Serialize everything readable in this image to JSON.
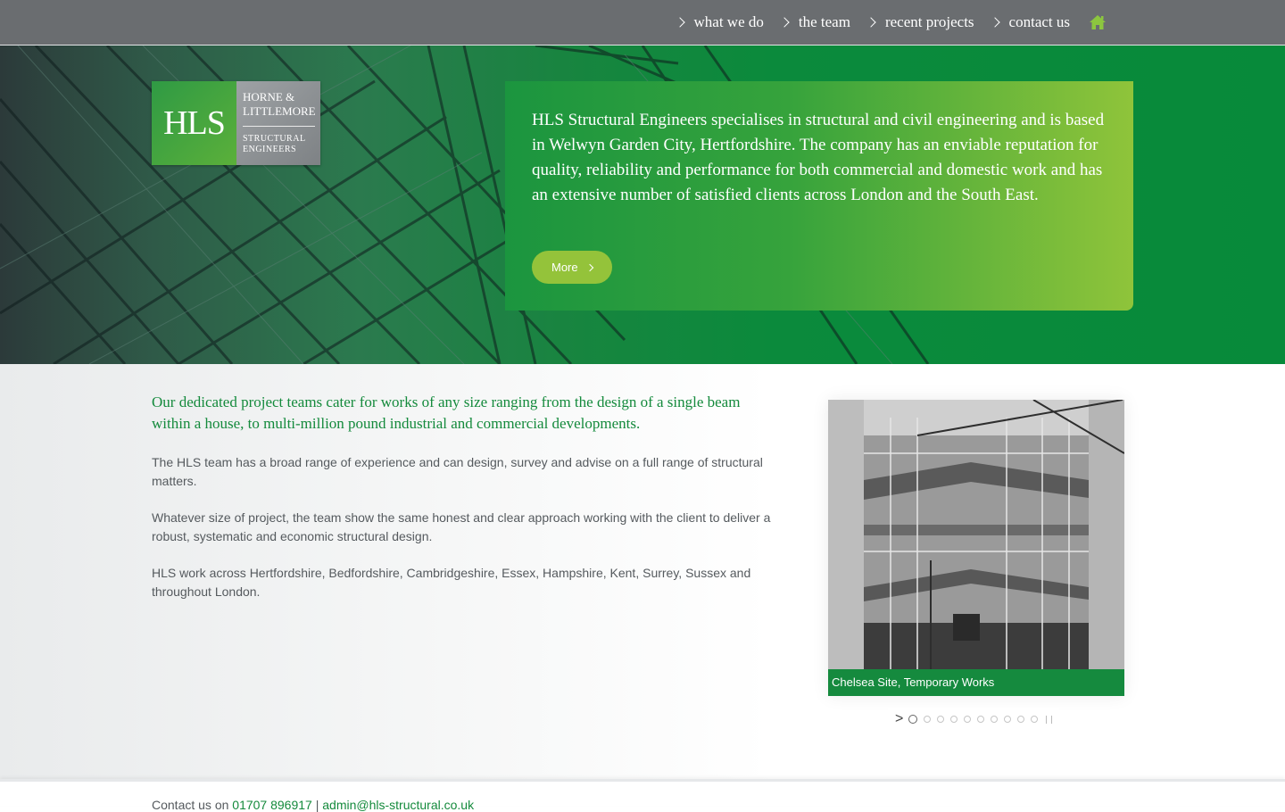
{
  "nav": {
    "items": [
      {
        "label": "what we do"
      },
      {
        "label": "the team"
      },
      {
        "label": "recent projects"
      },
      {
        "label": "contact us"
      }
    ],
    "home_icon": "home-icon",
    "icon_color": "#8cc63f"
  },
  "logo": {
    "mark": "HLS",
    "name_line1": "HORNE &",
    "name_line2": "LITTLEMORE",
    "sub_line1": "STRUCTURAL",
    "sub_line2": "ENGINEERS"
  },
  "hero": {
    "intro": "HLS Structural Engineers specialises in structural and civil engineering and is based in Welwyn Garden City, Hertfordshire. The company has an enviable reputation for quality, reliability and performance for both commercial and domestic work and has an extensive number of satisfied clients across London and the South East.",
    "more_label": "More"
  },
  "content": {
    "lead": "Our dedicated project teams cater for works of any size ranging from the design of a single beam within a house, to multi-million pound industrial and commercial developments.",
    "paragraphs": [
      "The HLS team has a broad range of experience and can design, survey and advise on a full range of structural matters.",
      "Whatever size of project, the team show the same honest and clear approach working with the client to deliver a robust, systematic and economic structural design.",
      "HLS work across Hertfordshire, Bedfordshire, Cambridgeshire, Essex, Hampshire, Kent, Surrey, Sussex and throughout London."
    ]
  },
  "slider": {
    "caption": "Chelsea Site, Temporary Works",
    "next_symbol": ">",
    "slide_count": 10,
    "active_index": 0
  },
  "footer": {
    "prefix": "Contact us on",
    "phone": "01707 896917",
    "separator": "|",
    "email": "admin@hls-structural.co.uk"
  },
  "colors": {
    "brand_green": "#148a3c",
    "accent_lime": "#94c33a",
    "nav_bg": "#6a6d70"
  }
}
